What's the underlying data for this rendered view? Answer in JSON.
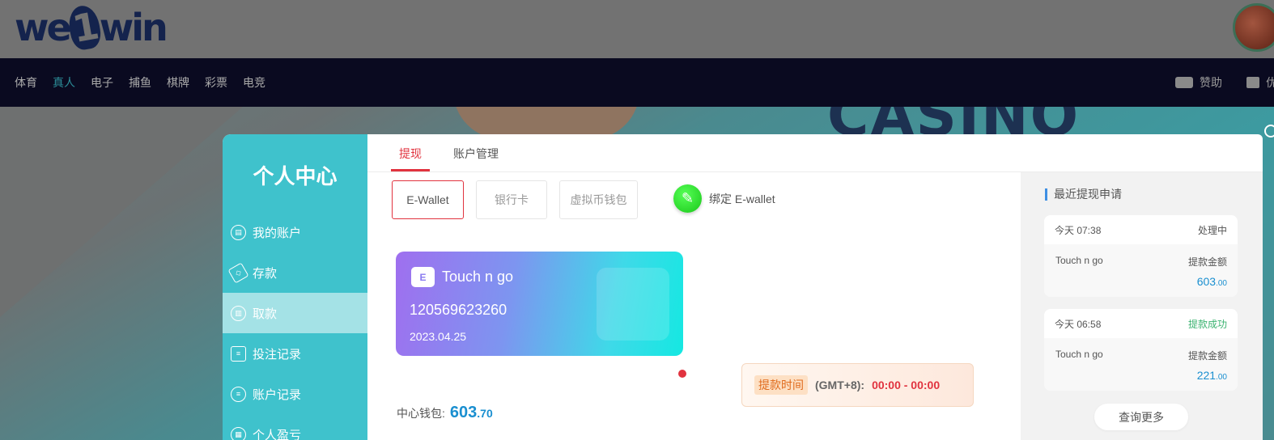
{
  "header": {
    "logo_text_a": "we",
    "logo_text_b": "1",
    "logo_text_c": "win"
  },
  "nav": {
    "items": [
      {
        "label": "体育"
      },
      {
        "label": "真人"
      },
      {
        "label": "电子"
      },
      {
        "label": "捕鱼"
      },
      {
        "label": "棋牌"
      },
      {
        "label": "彩票"
      },
      {
        "label": "电竞"
      }
    ],
    "active_index": 1,
    "right": {
      "sponsor_label": "赞助",
      "second_label": "优"
    }
  },
  "banner": {
    "word": "CASINO"
  },
  "sidebar": {
    "title": "个人中心",
    "items": [
      {
        "label": "我的账户",
        "icon": "account-icon"
      },
      {
        "label": "存款",
        "icon": "deposit-icon"
      },
      {
        "label": "取款",
        "icon": "withdraw-icon"
      },
      {
        "label": "投注记录",
        "icon": "bet-record-icon"
      },
      {
        "label": "账户记录",
        "icon": "account-record-icon"
      },
      {
        "label": "个人盈亏",
        "icon": "profit-loss-icon"
      }
    ],
    "active_index": 2
  },
  "tabs": [
    {
      "label": "提现"
    },
    {
      "label": "账户管理"
    }
  ],
  "methods": [
    {
      "label": "E-Wallet"
    },
    {
      "label": "银行卡"
    },
    {
      "label": "虚拟币钱包"
    }
  ],
  "bind": {
    "label": "绑定 E-wallet",
    "icon": "edit-pencil-icon"
  },
  "card": {
    "logo_glyph": "E",
    "name": "Touch n go",
    "number": "120569623260",
    "date": "2023.04.25"
  },
  "balance": {
    "label": "中心钱包:",
    "int": "603",
    "dec": ".70"
  },
  "withdraw_time": {
    "tag": "提款时间",
    "gmt": "(GMT+8):",
    "range": "00:00 - 00:00"
  },
  "recent": {
    "title": "最近提现申请",
    "records": [
      {
        "time": "今天 07:38",
        "status": "处理中",
        "method": "Touch n go",
        "amount_label": "提款金额",
        "amount_int": "603",
        "amount_dec": ".00"
      },
      {
        "time": "今天 06:58",
        "status": "提款成功",
        "method": "Touch n go",
        "amount_label": "提款金额",
        "amount_int": "221",
        "amount_dec": ".00"
      }
    ],
    "more_label": "查询更多"
  }
}
